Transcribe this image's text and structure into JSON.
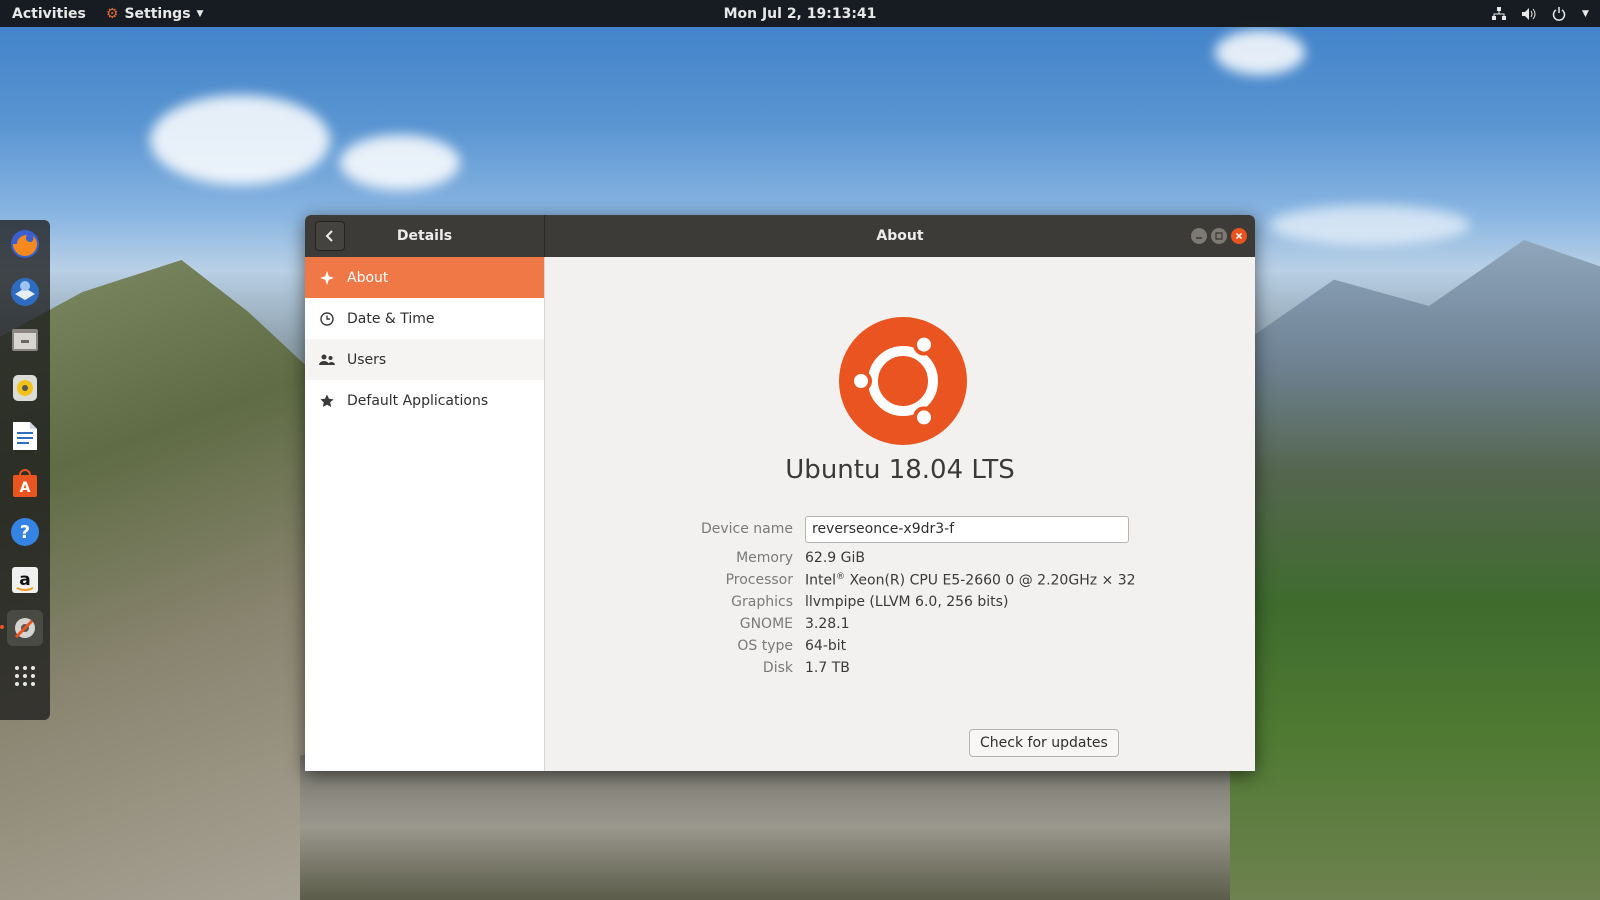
{
  "topbar": {
    "activities": "Activities",
    "app_menu": "Settings",
    "clock": "Mon Jul  2, 19:13:41"
  },
  "dock": {
    "items": [
      "firefox-icon",
      "thunderbird-icon",
      "files-icon",
      "rhythmbox-icon",
      "writer-icon",
      "software-center-icon",
      "help-icon",
      "amazon-icon",
      "settings-icon",
      "app-grid-icon"
    ]
  },
  "window": {
    "left_title": "Details",
    "right_title": "About"
  },
  "sidebar": {
    "items": [
      {
        "label": "About",
        "icon": "sparkle-icon",
        "selected": true
      },
      {
        "label": "Date & Time",
        "icon": "clock-icon"
      },
      {
        "label": "Users",
        "icon": "users-icon"
      },
      {
        "label": "Default Applications",
        "icon": "star-icon"
      }
    ]
  },
  "about": {
    "os_name": "Ubuntu 18.04 LTS",
    "device_name_label": "Device name",
    "device_name": "reverseonce-x9dr3-f",
    "memory_label": "Memory",
    "memory": "62.9 GiB",
    "processor_label": "Processor",
    "processor_prefix": "Intel",
    "processor_sup": "®",
    "processor_rest": " Xeon(R) CPU E5-2660 0 @ 2.20GHz × 32",
    "graphics_label": "Graphics",
    "graphics": "llvmpipe (LLVM 6.0, 256 bits)",
    "gnome_label": "GNOME",
    "gnome": "3.28.1",
    "os_type_label": "OS type",
    "os_type": "64-bit",
    "disk_label": "Disk",
    "disk": "1.7 TB",
    "update_button": "Check for updates"
  },
  "colors": {
    "accent": "#e95420",
    "selected_row": "#f07746",
    "titlebar": "#3d3b37"
  }
}
